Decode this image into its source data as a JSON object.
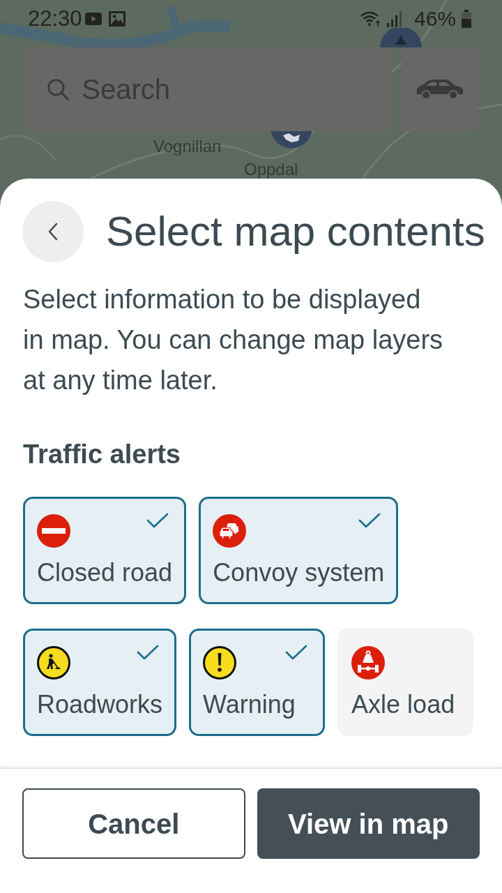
{
  "status_bar": {
    "time": "22:30",
    "battery": "46%"
  },
  "map": {
    "labels": [
      "Vognillan",
      "Oppdal"
    ]
  },
  "search": {
    "placeholder": "Search"
  },
  "sheet": {
    "title": "Select map contents",
    "description": "Select information to be displayed\nin map. You can change map layers\nat any time later.",
    "section": "Traffic alerts",
    "options": [
      {
        "label": "Closed road",
        "selected": true
      },
      {
        "label": "Convoy system",
        "selected": true
      },
      {
        "label": "Roadworks",
        "selected": true
      },
      {
        "label": "Warning",
        "selected": true
      },
      {
        "label": "Axle load",
        "selected": false
      }
    ]
  },
  "buttons": [
    {
      "label": "Cancel",
      "kind": "secondary"
    },
    {
      "label": "View in map",
      "kind": "primary"
    }
  ]
}
